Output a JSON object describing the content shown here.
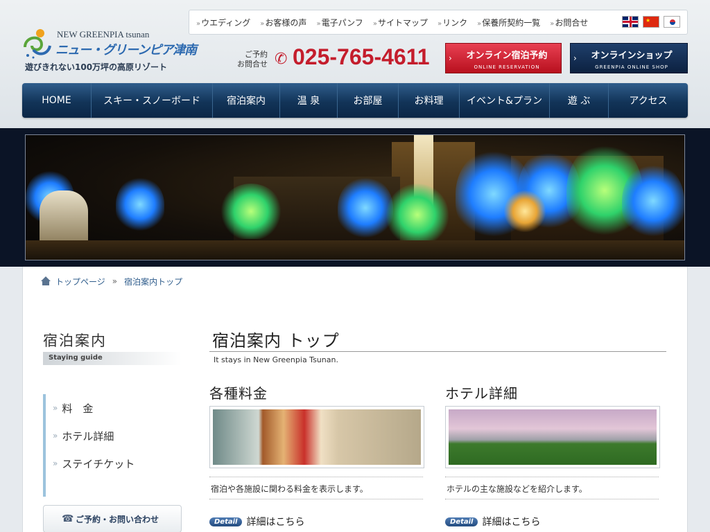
{
  "header": {
    "logo_en": "NEW GREENPIA tsunan",
    "logo_ja": "ニュー・グリーンピア津南",
    "tagline": "遊びきれない100万坪の高原リゾート",
    "contact_label": "ご予約\nお問合せ",
    "phone": "025-765-4611",
    "reserve_main": "オンライン宿泊予約",
    "reserve_sub": "ONLINE RESERVATION",
    "shop_main": "オンラインショップ",
    "shop_sub": "GREENPIA ONLINE SHOP"
  },
  "topnav": [
    "ウエディング",
    "お客様の声",
    "電子パンフ",
    "サイトマップ",
    "リンク",
    "保養所契約一覧",
    "お問合せ"
  ],
  "languages": [
    "uk-flag-icon",
    "china-flag-icon",
    "korea-flag-icon"
  ],
  "mainnav": [
    {
      "label": "HOME",
      "width": 100
    },
    {
      "label": "スキー・スノーボード",
      "width": 175
    },
    {
      "label": "宿泊案内",
      "width": 97
    },
    {
      "label": "温 泉",
      "width": 83
    },
    {
      "label": "お部屋",
      "width": 88
    },
    {
      "label": "お料理",
      "width": 88
    },
    {
      "label": "イベント&プラン",
      "width": 130
    },
    {
      "label": "遊 ぶ",
      "width": 85
    },
    {
      "label": "アクセス",
      "width": 114
    }
  ],
  "breadcrumb": {
    "home": "トップページ",
    "separator": "»",
    "current": "宿泊案内トップ"
  },
  "sidebar": {
    "title": "宿泊案内",
    "subtitle": "Staying guide",
    "items": [
      "料　金",
      "ホテル詳細",
      "ステイチケット"
    ],
    "contact": "ご予約・お問い合わせ"
  },
  "main": {
    "title": "宿泊案内 トップ",
    "subtitle": "It stays in New Greenpia Tsunan.",
    "cards": [
      {
        "title": "各種料金",
        "desc": "宿泊や各施設に関わる料金を表示します。",
        "badge": "Detail",
        "link": "詳細はこちら"
      },
      {
        "title": "ホテル詳細",
        "desc": "ホテルの主な施設などを紹介します。",
        "badge": "Detail",
        "link": "詳細はこちら"
      }
    ]
  },
  "colors": {
    "accent_red": "#c41d2c",
    "nav_blue": "#123458",
    "link_blue": "#2f5d8c"
  }
}
